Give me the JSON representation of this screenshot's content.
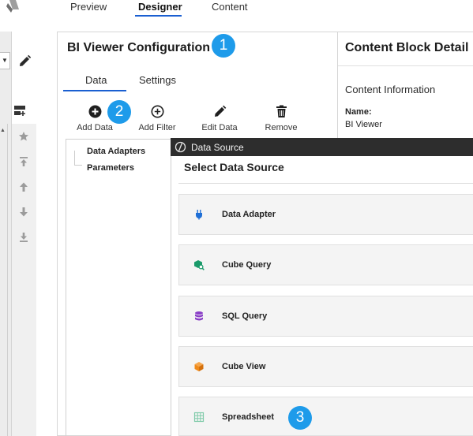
{
  "top_tabs": [
    {
      "label": "Preview",
      "active": false
    },
    {
      "label": "Designer",
      "active": true
    },
    {
      "label": "Content",
      "active": false
    }
  ],
  "bi_viewer": {
    "title": "BI Viewer Configuration",
    "tabs": [
      {
        "label": "Data",
        "active": true
      },
      {
        "label": "Settings",
        "active": false
      }
    ],
    "toolbar": [
      {
        "label": "Add Data",
        "icon": "plus-circle-filled-icon"
      },
      {
        "label": "Add Filter",
        "icon": "plus-circle-outline-icon"
      },
      {
        "label": "Edit Data",
        "icon": "pencil-icon"
      },
      {
        "label": "Remove",
        "icon": "trash-icon"
      }
    ],
    "tree": [
      "Data Adapters",
      "Parameters"
    ]
  },
  "content_block": {
    "title": "Content Block Detail",
    "section": "Content Information",
    "name_label": "Name:",
    "name_value": "BI Viewer"
  },
  "data_source": {
    "window_title": "Data Source",
    "heading": "Select Data Source",
    "options": [
      {
        "label": "Data Adapter",
        "icon": "plug-icon",
        "color": "#1f6fd6"
      },
      {
        "label": "Cube Query",
        "icon": "cube-search-icon",
        "color": "#1a9a6a"
      },
      {
        "label": "SQL Query",
        "icon": "database-icon",
        "color": "#8a3fc7"
      },
      {
        "label": "Cube View",
        "icon": "cube-icon",
        "color": "#ef8a1a"
      },
      {
        "label": "Spreadsheet",
        "icon": "grid-icon",
        "color": "#7fcaa9"
      }
    ]
  },
  "markers": [
    "1",
    "2",
    "3"
  ],
  "colors": {
    "accent": "#1a5fd1",
    "marker": "#1e9bea",
    "dialog_titlebar": "#2d2d2d"
  }
}
